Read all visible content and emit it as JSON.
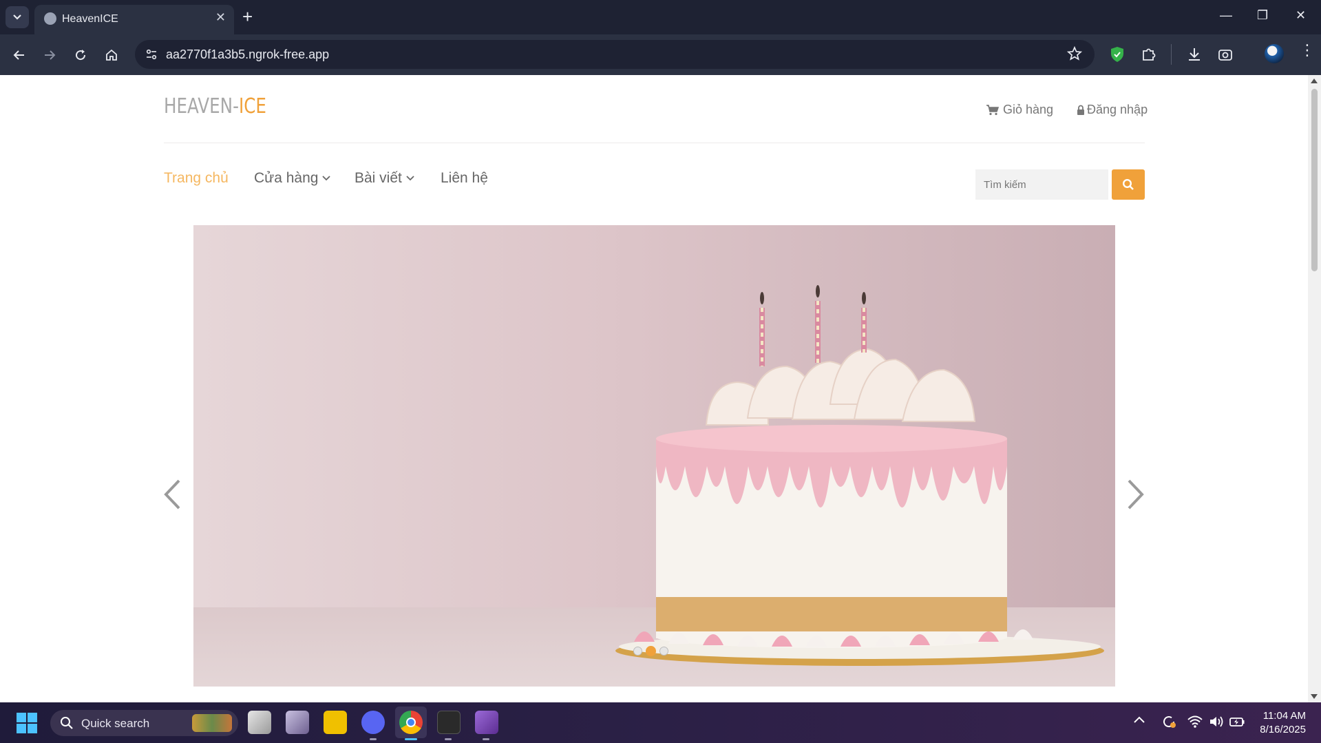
{
  "browser": {
    "tab_title": "HeavenICE",
    "url": "aa2770f1a3b5.ngrok-free.app"
  },
  "site": {
    "logo_part1": "HEAVEN-",
    "logo_part2": "ICE",
    "header": {
      "cart": "Giỏ hàng",
      "login": "Đăng nhập"
    },
    "nav": [
      {
        "label": "Trang chủ"
      },
      {
        "label": "Cửa hàng"
      },
      {
        "label": "Bài viết"
      },
      {
        "label": "Liên hệ"
      }
    ],
    "search": {
      "placeholder": "Tìm kiếm"
    },
    "slider": {
      "active_index": 2,
      "count": 3
    }
  },
  "colors": {
    "accent": "#f0a13a",
    "nav_active": "#f5b760",
    "chrome_dark": "#1e2233"
  },
  "taskbar": {
    "search_label": "Quick search",
    "time": "11:04 AM",
    "date": "8/16/2025"
  }
}
